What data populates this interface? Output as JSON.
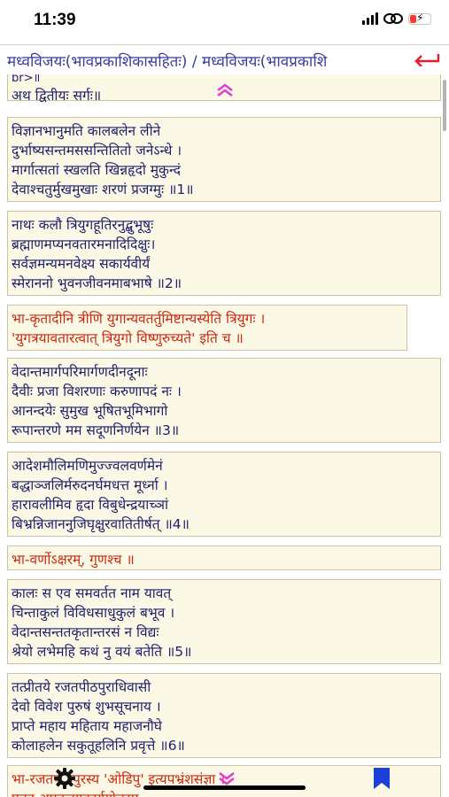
{
  "status": {
    "time": "11:39",
    "battery_level": 0.25,
    "battery_color": "#ff3b30"
  },
  "header": {
    "title": "मध्वविजयः(भावप्रकाशिकासहितः) / मध्वविजयः(भावप्रकाशि",
    "back_icon": "back-arrow-icon",
    "accent": "#e0202e"
  },
  "cards": [
    {
      "lines": [
        "br>॥",
        "अथ द्वितीयः सर्गः॥"
      ]
    },
    {
      "lines": [
        "विज्ञानभानुमति कालबलेन लीने",
        "दुर्भाष्यसन्तमससन्तितितो जनेऽन्धे ।",
        "मार्गात्सतां स्खलति खिन्नहृदो मुकुन्दं",
        "देवाश्चतुर्मुखमुखाः शरणं प्रजग्मुः ॥1॥"
      ]
    },
    {
      "lines": [
        "नाथः कलौ त्रियुगहूतिरनुद्बुभूषुः",
        "ब्रह्माणमप्यनवतारमनादिदिक्षुः।",
        "सर्वज्ञमन्यमनवेक्ष्य सकार्यवीर्यं",
        "स्मेराननो भुवनजीवनमाबभाषे ॥2॥"
      ]
    },
    {
      "lines": [
        "भा-कृतादीनि त्रीणि युगान्यवतर्तुमिष्टान्यस्येति त्रियुगः ।",
        "'युगत्रयावतारत्वात् त्रियुगो विष्णुरुच्यते' इति च ॥"
      ],
      "comment": true
    },
    {
      "lines": [
        "वेदान्तमार्गपरिमार्गणदीनदूनाः",
        "दैवीः प्रजा विशरणाः करुणापदं नः ।",
        "आनन्दयेः सुमुख भूषितभूमिभागो",
        "रूपान्तरणे मम सदूणनिर्णयेन ॥3॥"
      ]
    },
    {
      "lines": [
        "आदेशमौलिमणिमुज्ज्वलवर्णमेनं",
        "बद्धाञ्जलिर्मरुदनर्घमधत्त मूर्ध्ना ।",
        "हारावलीमिव हृदा विबुधेन्द्रयाच्ञां",
        "बिभ्रन्निजाननुजिघृक्षुरवातितीर्षत् ॥4॥"
      ]
    },
    {
      "lines": [
        "भा-वर्णोऽक्षरम्, गुणश्च ॥"
      ],
      "comment": true
    },
    {
      "lines": [
        "कालः स एव समवर्तत नाम यावत्",
        "चिन्ताकुलं विविधसाधुकुलं बभूव ।",
        "वेदान्तसन्ततकृतान्तरसं न विद्यः",
        "श्रेयो लभेमहि कथं नु वयं बतेति ॥5॥"
      ]
    },
    {
      "lines": [
        "तत्प्रीतये रजतपीठपुराधिवासी",
        "देवो विवेश पुरुषं शुभसूचनाय ।",
        "प्राप्ते महाय महिताय महाजनौघे",
        "कोलाहलेन सकुतूहलिनि प्रवृत्ते ॥6॥"
      ]
    },
    {
      "lines": [
        "भा-रजतपीठपुरस्य 'ओडिपु' इत्यपभ्रंशसंज्ञा ।",
        "एतत्र अपनजगकार्यगोचरम"
      ],
      "comment": true
    }
  ],
  "toolbar": {
    "settings_icon": "gear-icon",
    "bookmark_icon": "bookmark-icon",
    "scroll_down_icon": "chevron-down-icon",
    "scroll_up_icon": "chevron-up-icon"
  }
}
